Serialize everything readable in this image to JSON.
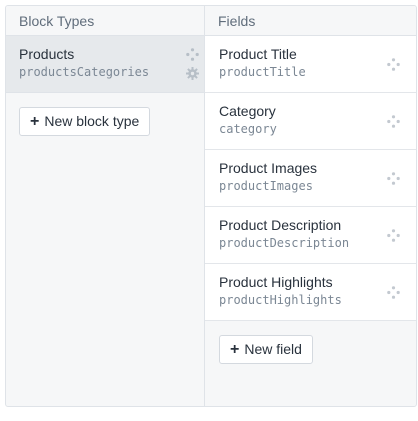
{
  "left": {
    "header": "Block Types",
    "items": [
      {
        "name": "Products",
        "handle": "productsCategories"
      }
    ],
    "new_button": {
      "plus": "+",
      "label": "New block type"
    }
  },
  "right": {
    "header": "Fields",
    "items": [
      {
        "name": "Product Title",
        "handle": "productTitle"
      },
      {
        "name": "Category",
        "handle": "category"
      },
      {
        "name": "Product Images",
        "handle": "productImages"
      },
      {
        "name": "Product Description",
        "handle": "productDescription"
      },
      {
        "name": "Product Highlights",
        "handle": "productHighlights"
      }
    ],
    "new_button": {
      "plus": "+",
      "label": "New field"
    }
  },
  "icons": {
    "move": "move-icon",
    "settings": "gear-icon"
  }
}
